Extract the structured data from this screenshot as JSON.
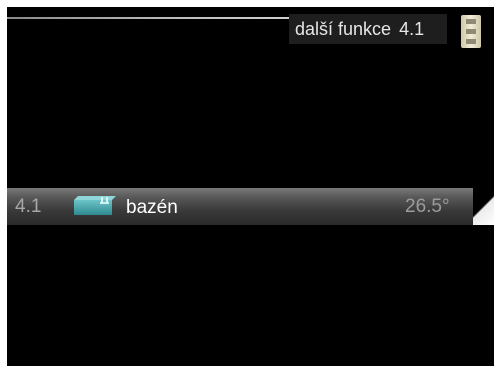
{
  "header": {
    "title": "další funkce",
    "menu_number": "4.1",
    "scroll_icon": "scroll-indicator-icon"
  },
  "menu": {
    "items": [
      {
        "number": "4.1",
        "icon": "pool-icon",
        "label": "bazén",
        "value": "26.5°"
      }
    ]
  },
  "colors": {
    "background": "#000000",
    "header_bg": "#1e1e1e",
    "pool_icon": "#4aa7ad",
    "scroll_icon": "#e8e0c4"
  }
}
